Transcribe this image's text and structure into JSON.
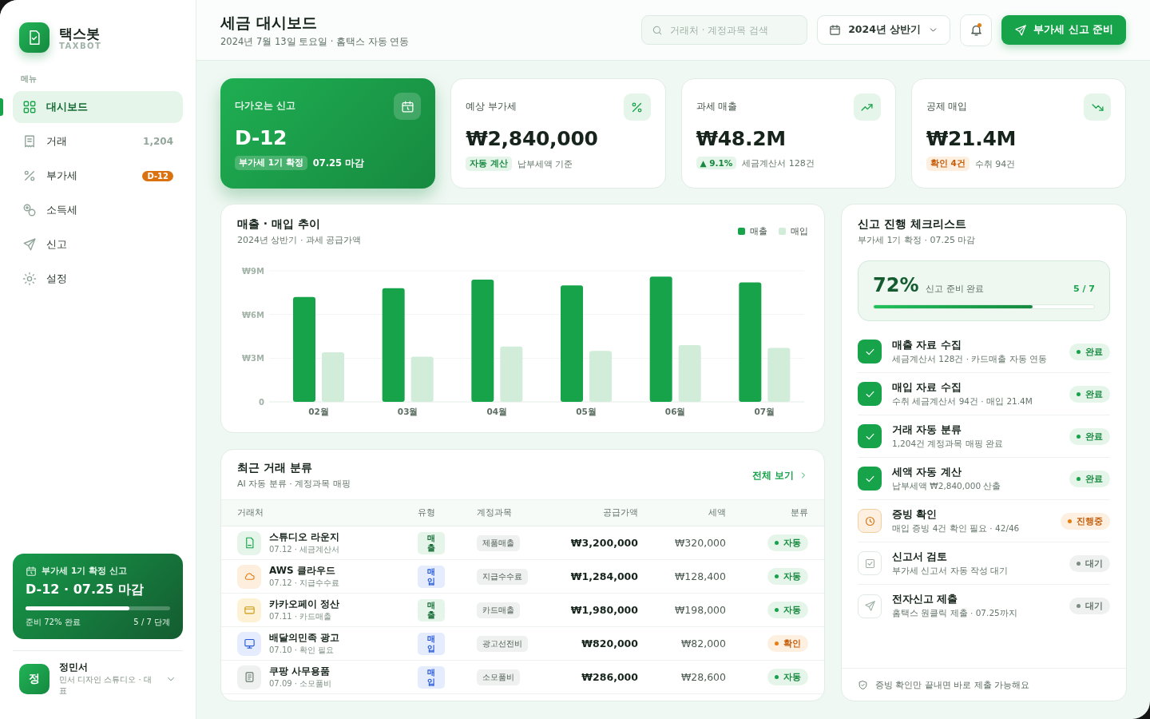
{
  "sidebar": {
    "brand": {
      "name": "택스봇",
      "sub": "TAXBOT"
    },
    "section_label": "메뉴",
    "items": [
      {
        "label": "대시보드",
        "selected": true
      },
      {
        "label": "거래",
        "count": "1,204",
        "selected": false
      },
      {
        "label": "부가세",
        "badge": "D-12",
        "selected": false
      },
      {
        "label": "소득세",
        "selected": false
      },
      {
        "label": "신고",
        "selected": false
      },
      {
        "label": "설정",
        "selected": false
      }
    ],
    "promo": {
      "title": "부가세 1기 확정 신고",
      "headline": "D-12 · 07.25 마감",
      "level": 0.72,
      "left": "준비 72% 완료",
      "right": "5 / 7 단계"
    },
    "user": {
      "avatar": "정",
      "name": "정민서",
      "role": "민서 디자인 스튜디오 · 대표"
    }
  },
  "header": {
    "title": "세금 대시보드",
    "subtitle": "2024년 7월 13일 토요일 · 홈택스 자동 연동",
    "search": {
      "placeholder": "거래처 · 계정과목 검색"
    },
    "period": "2024년 상반기",
    "notifications": {
      "unread": true
    },
    "primary_button": "부가세 신고 준비"
  },
  "stat_cards": [
    {
      "kind": "highlight",
      "label": "다가오는 신고",
      "value": "D-12",
      "tag": {
        "text": "부가세 1기 확정",
        "kind": "highlight"
      },
      "note": "07.25 마감"
    },
    {
      "kind": "stat",
      "label": "예상 부가세",
      "value": "₩2,840,000",
      "tag": {
        "text": "자동 계산",
        "kind": "ok"
      },
      "note": "납부세액 기준"
    },
    {
      "kind": "stat",
      "label": "과세 매출",
      "value": "₩48.2M",
      "tag": {
        "text": "▲ 9.1%",
        "kind": "ok"
      },
      "note": "세금계산서 128건"
    },
    {
      "kind": "stat",
      "label": "공제 매입",
      "value": "₩21.4M",
      "tag": {
        "text": "확인 4건",
        "kind": "warn"
      },
      "note": "수취 94건"
    }
  ],
  "trend": {
    "title": "매출 · 매입 추이",
    "subtitle": "2024년 상반기 · 과세 공급가액",
    "chart_data": {
      "type": "bar",
      "categories": [
        "02월",
        "03월",
        "04월",
        "05월",
        "06월",
        "07월"
      ],
      "series": [
        {
          "name": "매출",
          "color": "#16a34a",
          "values": [
            7.2,
            7.8,
            8.4,
            8.0,
            8.6,
            8.2
          ]
        },
        {
          "name": "매입",
          "color": "#d1ecd9",
          "values": [
            3.4,
            3.1,
            3.8,
            3.5,
            3.9,
            3.7
          ]
        }
      ],
      "ylim": [
        0,
        9
      ],
      "yticks": [
        {
          "value": 0,
          "label": "0"
        },
        {
          "value": 3,
          "label": "₩3M"
        },
        {
          "value": 6,
          "label": "₩6M"
        },
        {
          "value": 9,
          "label": "₩9M"
        }
      ]
    }
  },
  "transactions": {
    "title": "최근 거래 분류",
    "subtitle": "AI 자동 분류 · 계정과목 매핑",
    "link": "전체 보기",
    "columns": [
      "거래처",
      "유형",
      "계정과목",
      "공급가액",
      "세액",
      "분류"
    ],
    "rows": [
      {
        "name": "스튜디오 라운지",
        "sub": "07.12 · 세금계산서",
        "type": {
          "text": "매출",
          "kind": "sales"
        },
        "account": "제품매출",
        "amount": "₩3,200,000",
        "tax": "₩320,000",
        "status": {
          "text": "자동",
          "kind": "auto"
        }
      },
      {
        "name": "AWS 클라우드",
        "sub": "07.12 · 지급수수료",
        "type": {
          "text": "매입",
          "kind": "purchase"
        },
        "account": "지급수수료",
        "amount": "₩1,284,000",
        "tax": "₩128,400",
        "status": {
          "text": "자동",
          "kind": "auto"
        }
      },
      {
        "name": "카카오페이 정산",
        "sub": "07.11 · 카드매출",
        "type": {
          "text": "매출",
          "kind": "sales"
        },
        "account": "카드매출",
        "amount": "₩1,980,000",
        "tax": "₩198,000",
        "status": {
          "text": "자동",
          "kind": "auto"
        }
      },
      {
        "name": "배달의민족 광고",
        "sub": "07.10 · 확인 필요",
        "type": {
          "text": "매입",
          "kind": "purchase"
        },
        "account": "광고선전비",
        "amount": "₩820,000",
        "tax": "₩82,000",
        "status": {
          "text": "확인",
          "kind": "check"
        }
      },
      {
        "name": "쿠팡 사무용품",
        "sub": "07.09 · 소모품비",
        "type": {
          "text": "매입",
          "kind": "purchase"
        },
        "account": "소모품비",
        "amount": "₩286,000",
        "tax": "₩28,600",
        "status": {
          "text": "자동",
          "kind": "auto"
        }
      }
    ]
  },
  "checklist": {
    "title": "신고 진행 체크리스트",
    "subtitle": "부가세 1기 확정 · 07.25 마감",
    "progress": {
      "percent": "72%",
      "label": "신고 준비 완료",
      "count": "5 / 7",
      "level": 0.72
    },
    "items": [
      {
        "title": "매출 자료 수집",
        "sub": "세금계산서 128건 · 카드매출 자동 연동",
        "kind": "done",
        "status": "완료"
      },
      {
        "title": "매입 자료 수집",
        "sub": "수취 세금계산서 94건 · 매입 21.4M",
        "kind": "done",
        "status": "완료"
      },
      {
        "title": "거래 자동 분류",
        "sub": "1,204건 계정과목 매핑 완료",
        "kind": "done",
        "status": "완료"
      },
      {
        "title": "세액 자동 계산",
        "sub": "납부세액 ₩2,840,000 산출",
        "kind": "done",
        "status": "완료"
      },
      {
        "title": "증빙 확인",
        "sub": "매입 증빙 4건 확인 필요 · 42/46",
        "kind": "progress",
        "status": "진행중"
      },
      {
        "title": "신고서 검토",
        "sub": "부가세 신고서 자동 작성 대기",
        "kind": "waiting",
        "status": "대기"
      },
      {
        "title": "전자신고 제출",
        "sub": "홈택스 원클릭 제출 · 07.25까지",
        "kind": "waiting",
        "status": "대기"
      }
    ],
    "footer": "증빙 확인만 끝내면 바로 제출 가능해요"
  }
}
